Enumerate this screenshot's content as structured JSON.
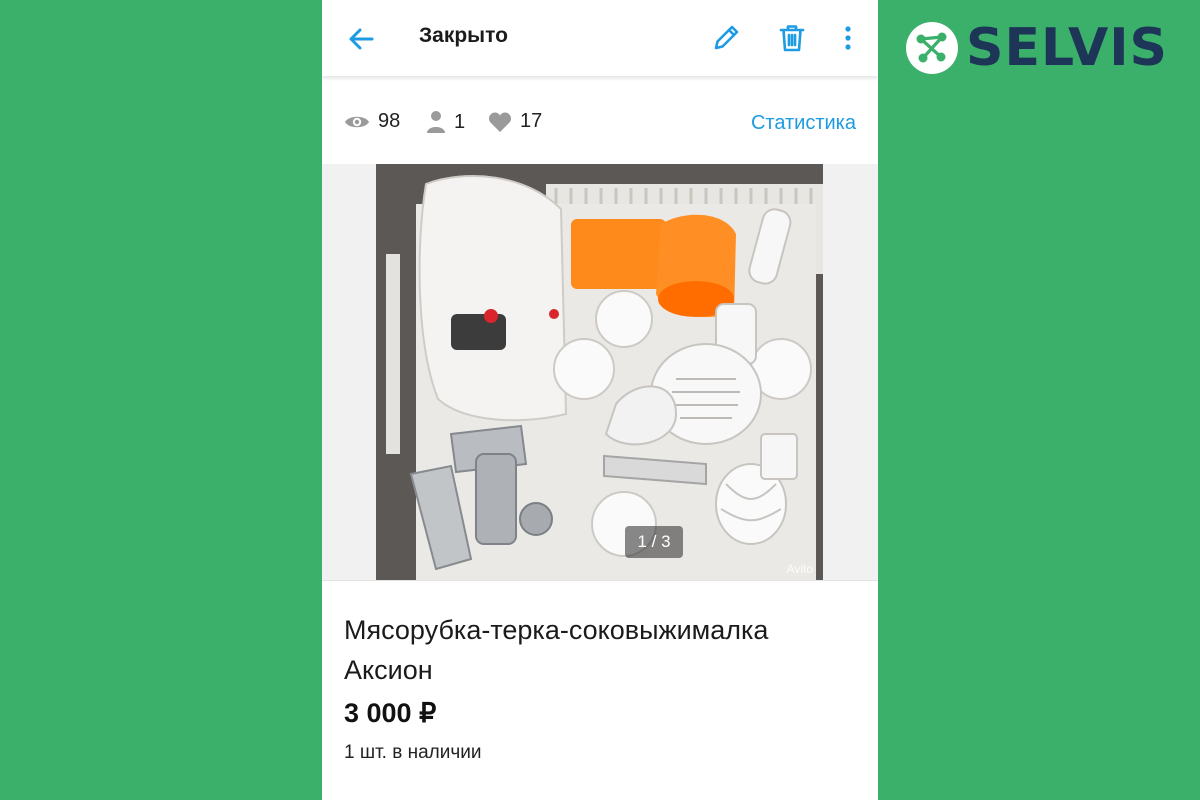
{
  "header": {
    "title": "Закрыто"
  },
  "stats": {
    "views": "98",
    "contacts": "1",
    "favorites": "17",
    "link_label": "Статистика"
  },
  "gallery": {
    "counter": "1 / 3",
    "watermark": "Avito"
  },
  "listing": {
    "title": "Мясорубка-терка-соковыжималка Аксион",
    "price": "3 000 ₽",
    "stock": "1 шт. в наличии"
  },
  "brand": {
    "name": "SELVIS"
  },
  "colors": {
    "background": "#3bb06b",
    "accent": "#1d9be3",
    "brand_text": "#1d3557"
  },
  "icons": [
    "back-arrow-icon",
    "pencil-icon",
    "trash-icon",
    "more-vertical-icon",
    "eye-icon",
    "person-icon",
    "heart-icon"
  ]
}
